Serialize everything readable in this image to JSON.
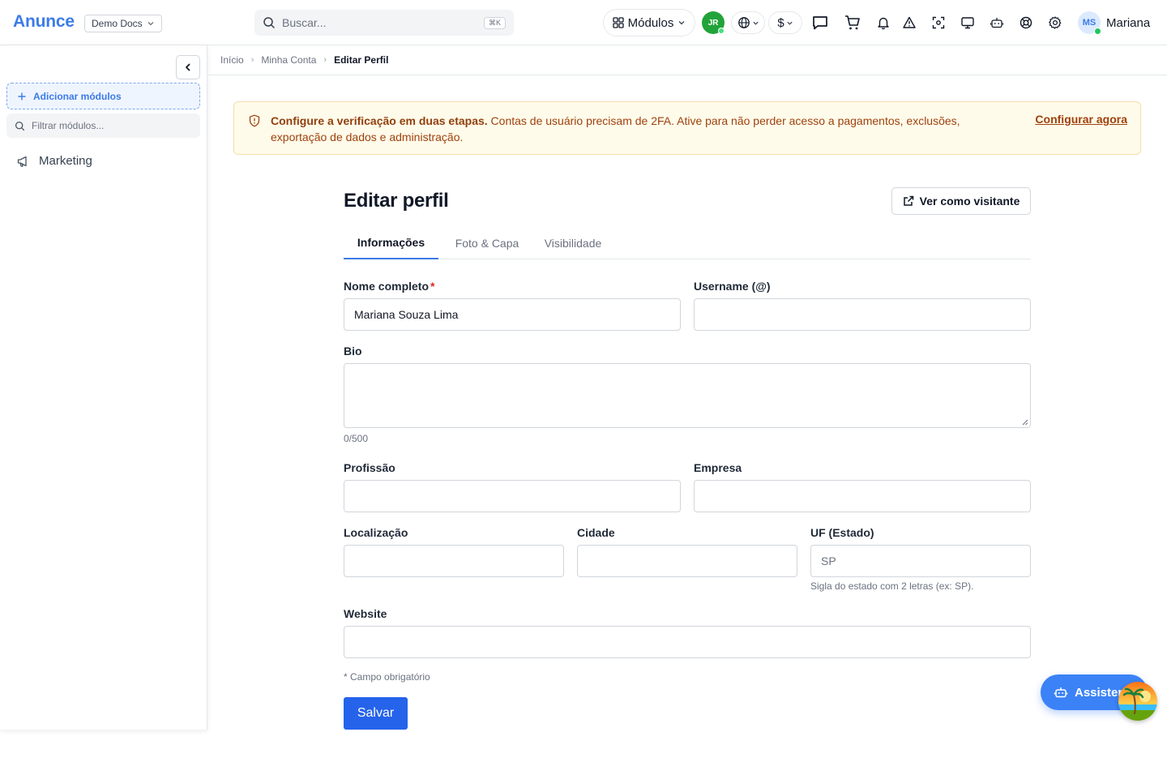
{
  "header": {
    "brand": "Anunce",
    "org_select": "Demo Docs",
    "search_placeholder": "Buscar...",
    "search_shortcut": "⌘K",
    "modules_label": "Módulos",
    "avatar_jr": "JR",
    "currency": "$",
    "user_initials": "MS",
    "user_name": "Mariana"
  },
  "sidebar": {
    "add_modules": "Adicionar módulos",
    "filter_placeholder": "Filtrar módulos...",
    "items": [
      {
        "label": "Marketing"
      }
    ]
  },
  "breadcrumb": [
    "Início",
    "Minha Conta",
    "Editar Perfil"
  ],
  "alert": {
    "title": "Configure a verificação em duas etapas.",
    "message": "Contas de usuário precisam de 2FA. Ative para não perder acesso a pagamentos, exclusões, exportação de dados e administração.",
    "action": "Configurar agora"
  },
  "page": {
    "title": "Editar perfil",
    "view_as_visitor": "Ver como visitante"
  },
  "tabs": [
    "Informações",
    "Foto & Capa",
    "Visibilidade"
  ],
  "form": {
    "full_name_label": "Nome completo",
    "full_name_required": "*",
    "full_name_value": "Mariana Souza Lima",
    "username_label": "Username (@)",
    "username_value": "",
    "bio_label": "Bio",
    "bio_counter": "0/500",
    "profession_label": "Profissão",
    "company_label": "Empresa",
    "location_label": "Localização",
    "city_label": "Cidade",
    "state_label": "UF (Estado)",
    "state_placeholder": "SP",
    "state_hint": "Sigla do estado com 2 letras (ex: SP).",
    "website_label": "Website",
    "required_note": "* Campo obrigatório",
    "save_label": "Salvar"
  },
  "assistant": {
    "label": "Assistente"
  },
  "colors": {
    "brand": "#3b7be8",
    "primary_button": "#2563eb",
    "alert_bg": "#fefbea",
    "alert_text": "#a0410d",
    "online": "#22c55e"
  }
}
